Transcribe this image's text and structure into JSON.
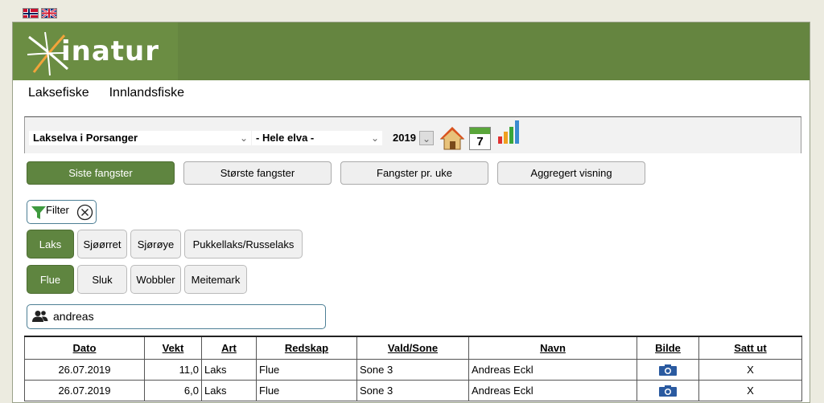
{
  "languages": [
    {
      "name": "norwegian-flag-icon"
    },
    {
      "name": "uk-flag-icon"
    }
  ],
  "brand": {
    "logo_text": "inatur"
  },
  "nav": {
    "items": [
      "Laksefiske",
      "Innlandsfiske"
    ]
  },
  "selectors": {
    "river": "Lakselva i Porsanger",
    "zone": "- Hele elva -",
    "year": "2019",
    "calendar_day": "7"
  },
  "tabs": [
    {
      "label": "Siste fangster",
      "active": true
    },
    {
      "label": "Største fangster",
      "active": false
    },
    {
      "label": "Fangster pr. uke",
      "active": false
    },
    {
      "label": "Aggregert visning",
      "active": false
    }
  ],
  "filter": {
    "label": "Filter"
  },
  "species": [
    {
      "label": "Laks",
      "active": true
    },
    {
      "label": "Sjøørret",
      "active": false
    },
    {
      "label": "Sjørøye",
      "active": false
    },
    {
      "label": "Pukkellaks/Russelaks",
      "active": false
    }
  ],
  "gear": [
    {
      "label": "Flue",
      "active": true
    },
    {
      "label": "Sluk",
      "active": false
    },
    {
      "label": "Wobbler",
      "active": false
    },
    {
      "label": "Meitemark",
      "active": false
    }
  ],
  "search": {
    "value": "andreas"
  },
  "table": {
    "headers": [
      "Dato",
      "Vekt",
      "Art",
      "Redskap",
      "Vald/Sone",
      "Navn",
      "Bilde",
      "Satt ut"
    ],
    "rows": [
      {
        "dato": "26.07.2019",
        "vekt": "11,0",
        "art": "Laks",
        "redskap": "Flue",
        "sone": "Sone 3",
        "navn": "Andreas Eckl",
        "satt_ut": "X"
      },
      {
        "dato": "26.07.2019",
        "vekt": "6,0",
        "art": "Laks",
        "redskap": "Flue",
        "sone": "Sone 3",
        "navn": "Andreas Eckl",
        "satt_ut": "X"
      }
    ]
  },
  "colors": {
    "brand_green": "#658540",
    "active_button": "#5f8540"
  }
}
